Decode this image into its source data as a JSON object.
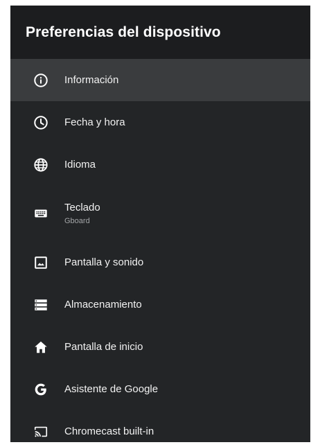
{
  "header": {
    "title": "Preferencias del dispositivo"
  },
  "items": [
    {
      "label": "Información",
      "icon": "info-icon",
      "selected": true
    },
    {
      "label": "Fecha y hora",
      "icon": "clock-icon"
    },
    {
      "label": "Idioma",
      "icon": "globe-icon"
    },
    {
      "label": "Teclado",
      "sublabel": "Gboard",
      "icon": "keyboard-icon"
    },
    {
      "label": "Pantalla y sonido",
      "icon": "image-icon"
    },
    {
      "label": "Almacenamiento",
      "icon": "storage-icon"
    },
    {
      "label": "Pantalla de inicio",
      "icon": "home-icon"
    },
    {
      "label": "Asistente de Google",
      "icon": "google-icon"
    },
    {
      "label": "Chromecast built-in",
      "icon": "cast-icon"
    }
  ],
  "colors": {
    "background": "#232527",
    "header": "#1c1d1f",
    "selected": "#3a3c3e",
    "text": "#f2f2f2",
    "subtext": "#a4a6a8"
  }
}
